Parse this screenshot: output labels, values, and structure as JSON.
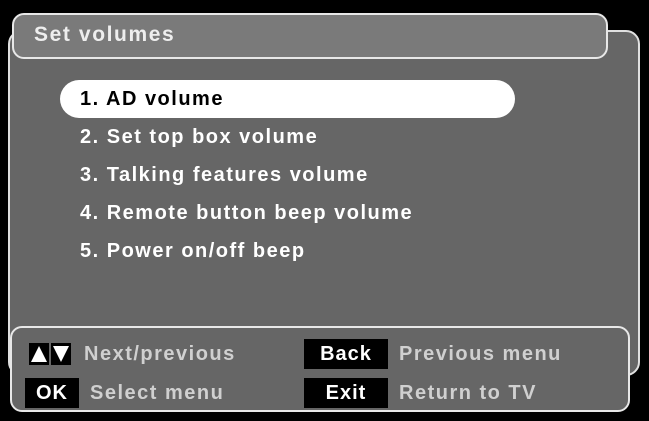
{
  "title": "Set volumes",
  "menu": {
    "items": [
      {
        "label": "1. AD volume",
        "selected": true
      },
      {
        "label": "2. Set top box volume",
        "selected": false
      },
      {
        "label": "3. Talking features volume",
        "selected": false
      },
      {
        "label": "4. Remote button beep volume",
        "selected": false
      },
      {
        "label": "5. Power on/off beep",
        "selected": false
      }
    ]
  },
  "footer": {
    "nav_hint": "Next/previous",
    "back_key": "Back",
    "back_hint": "Previous menu",
    "ok_key": "OK",
    "ok_hint": "Select menu",
    "exit_key": "Exit",
    "exit_hint": "Return to TV",
    "up_icon": "triangle-up",
    "down_icon": "triangle-down"
  },
  "colors": {
    "background": "#000000",
    "panel": "#666666",
    "highlight": "#ffffff",
    "key_bg": "#000000",
    "hint_text": "#d0d0d0"
  }
}
